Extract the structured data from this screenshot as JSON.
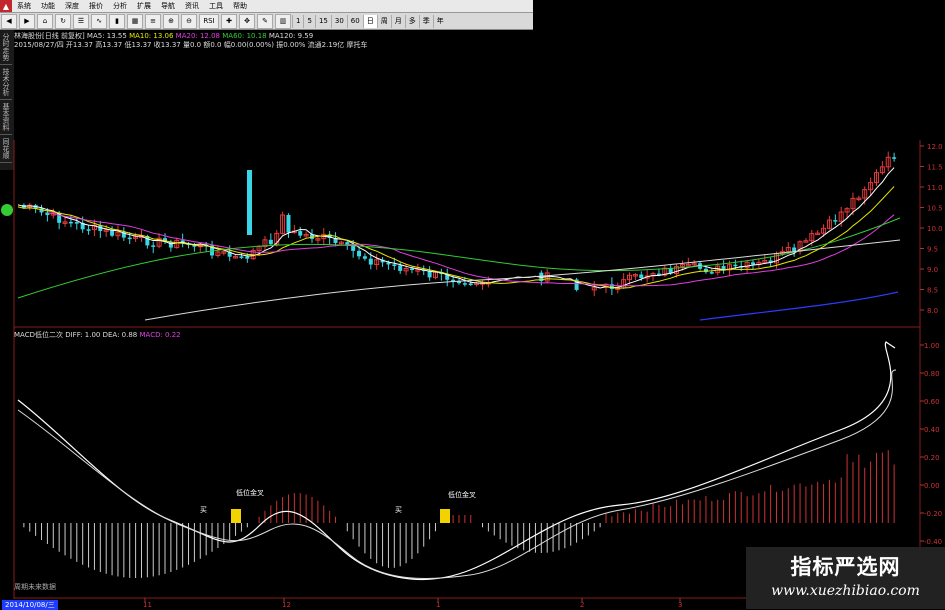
{
  "menu": {
    "items": [
      "系统",
      "功能",
      "深度",
      "报价",
      "分析",
      "扩展",
      "导航",
      "资讯",
      "工具",
      "帮助"
    ]
  },
  "toolbar": {
    "periods": [
      "1",
      "5",
      "15",
      "30",
      "60",
      "日",
      "周",
      "月",
      "多",
      "季",
      "年"
    ],
    "rsi_label": "RSI"
  },
  "left_tabs": [
    "分时走势",
    "技术分析",
    "基本资料",
    "同花顺"
  ],
  "quote": {
    "stock": "林海股份[日线 前复权]",
    "ma5": "MA5: 13.55",
    "ma10": "MA10: 13.06",
    "ma20": "MA20: 12.08",
    "ma60": "MA60: 10.18",
    "ma120": "MA120: 9.59",
    "bar_info": "2015/08/27/四 开13.37 高13.37 低13.37 收13.37 量0.0 额0.0 幅0.00(0.00%) 振0.00% 流通2.19亿 摩托车"
  },
  "macd": {
    "title": "MACD低位二次",
    "diff": "DIFF: 1.00",
    "dea": "DEA: 0.88",
    "macd": "MACD: 0.22"
  },
  "price_axis": [
    "12.0",
    "11.5",
    "11.0",
    "10.5",
    "10.0",
    "9.5",
    "9.0",
    "8.5",
    "8.0"
  ],
  "macd_axis": [
    "1.00",
    "0.80",
    "0.60",
    "0.40",
    "0.20",
    "0.00",
    "-0.20",
    "-0.40"
  ],
  "signals": {
    "buy": "买",
    "golden_cross": "低位金叉"
  },
  "x_axis": [
    "11",
    "12",
    "1",
    "2",
    "3"
  ],
  "bottom": {
    "date": "2014/10/08/三",
    "footnote": "周期未来数据"
  },
  "watermark": {
    "cn": "指标严选网",
    "url": "www.xuezhibiao.com"
  },
  "colors": {
    "up": "#e23b3b",
    "down": "#38d6e6",
    "ma5": "#ffffff",
    "ma10": "#e8e800",
    "ma20": "#e040e0",
    "ma60": "#3c3",
    "ma120": "#ddd",
    "blue": "#2a3cff"
  }
}
